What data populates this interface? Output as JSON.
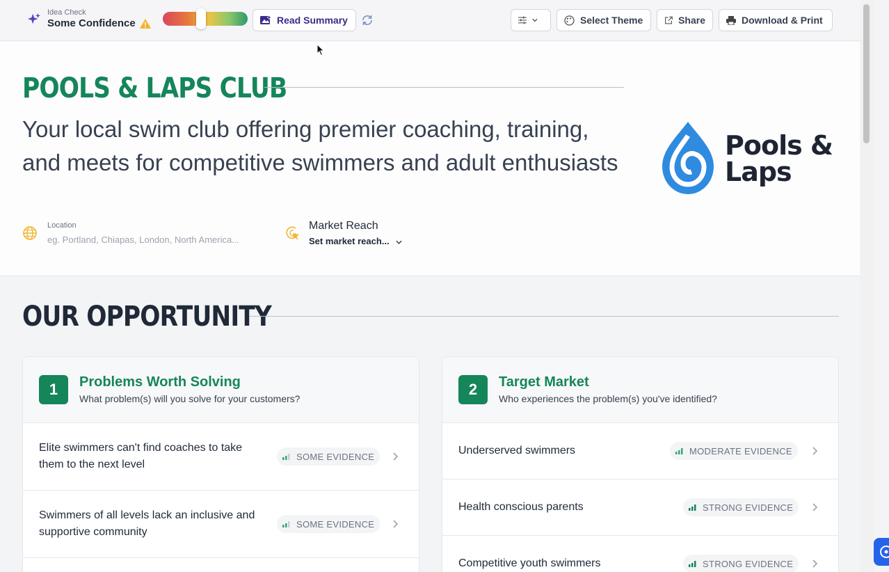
{
  "toolbar": {
    "idea_check_label": "Idea Check",
    "confidence": "Some Confidence",
    "confidence_level": 0.45,
    "read_summary": "Read Summary",
    "select_theme": "Select Theme",
    "share": "Share",
    "download_print": "Download & Print"
  },
  "hero": {
    "title": "POOLS & LAPS CLUB",
    "description": "Your local swim club offering premier coaching, training, and meets for competitive swimmers and adult enthusiasts",
    "location_label": "Location",
    "location_placeholder": "eg. Portland, Chiapas, London, North America...",
    "market_reach_label": "Market Reach",
    "market_reach_value": "Set market reach...",
    "logo_line1": "Pools &",
    "logo_line2": "Laps"
  },
  "opportunity": {
    "title": "OUR OPPORTUNITY",
    "cards": [
      {
        "number": "1",
        "title": "Problems Worth Solving",
        "subtitle": "What problem(s) will you solve for your customers?",
        "rows": [
          {
            "text": "Elite swimmers can't find coaches to take them to the next level",
            "badge": "SOME EVIDENCE"
          },
          {
            "text": "Swimmers of all levels lack an inclusive and supportive community",
            "badge": "SOME EVIDENCE"
          }
        ]
      },
      {
        "number": "2",
        "title": "Target Market",
        "subtitle": "Who experiences the problem(s) you've identified?",
        "rows": [
          {
            "text": "Underserved swimmers",
            "badge": "MODERATE EVIDENCE"
          },
          {
            "text": "Health conscious parents",
            "badge": "STRONG EVIDENCE"
          },
          {
            "text": "Competitive youth swimmers",
            "badge": "STRONG EVIDENCE"
          }
        ]
      }
    ]
  },
  "colors": {
    "brand_green": "#15855a",
    "summary_purple": "#3b2a8a",
    "logo_blue": "#2f8be0"
  }
}
